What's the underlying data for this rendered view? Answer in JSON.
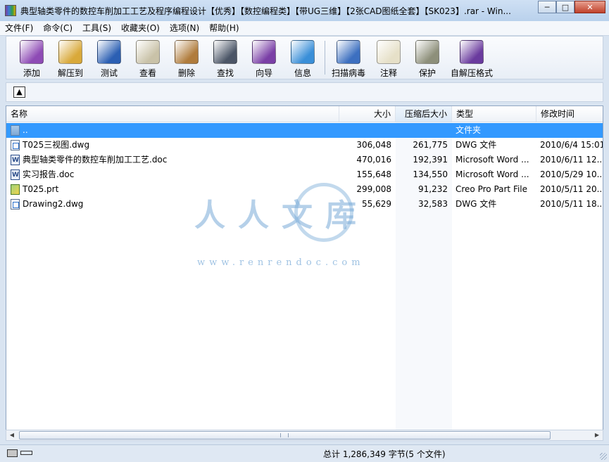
{
  "window": {
    "title": "典型轴类零件的数控车削加工工艺及程序编程设计【优秀】【数控编程类】【带UG三维】【2张CAD图纸全套】【SK023】.rar - Win...",
    "minimize": "─",
    "maximize": "□",
    "close": "✕"
  },
  "menu": {
    "items": [
      {
        "label": "文件(F)"
      },
      {
        "label": "命令(C)"
      },
      {
        "label": "工具(S)"
      },
      {
        "label": "收藏夹(O)"
      },
      {
        "label": "选项(N)"
      },
      {
        "label": "帮助(H)"
      }
    ]
  },
  "toolbar": {
    "buttons": [
      {
        "label": "添加",
        "icon": "add-archive-icon",
        "color": "#8e4bb5"
      },
      {
        "label": "解压到",
        "icon": "extract-to-icon",
        "color": "#d9a93a"
      },
      {
        "label": "测试",
        "icon": "test-icon",
        "color": "#2b5fb3"
      },
      {
        "label": "查看",
        "icon": "view-icon",
        "color": "#c9c2a8"
      },
      {
        "label": "删除",
        "icon": "delete-icon",
        "color": "#b07c3c"
      },
      {
        "label": "查找",
        "icon": "find-icon",
        "color": "#4b5566"
      },
      {
        "label": "向导",
        "icon": "wizard-icon",
        "color": "#7a3fa6"
      },
      {
        "label": "信息",
        "icon": "info-icon",
        "color": "#3a8fd8"
      },
      {
        "label": "扫描病毒",
        "icon": "scan-virus-icon",
        "color": "#3c6fc0"
      },
      {
        "label": "注释",
        "icon": "comment-icon",
        "color": "#e6e0c8"
      },
      {
        "label": "保护",
        "icon": "protect-icon",
        "color": "#8d8f7a"
      },
      {
        "label": "自解压格式",
        "icon": "sfx-icon",
        "color": "#6a3b9e"
      }
    ]
  },
  "columns": {
    "name": "名称",
    "size": "大小",
    "packed": "压缩后大小",
    "type": "类型",
    "modified": "修改时间"
  },
  "files": [
    {
      "name": "..",
      "size": "",
      "packed": "",
      "type": "文件夹",
      "modified": "",
      "icon": "folder"
    },
    {
      "name": "T025三视图.dwg",
      "size": "306,048",
      "packed": "261,775",
      "type": "DWG 文件",
      "modified": "2010/6/4 15:01",
      "icon": "dwg"
    },
    {
      "name": "典型轴类零件的数控车削加工工艺.doc",
      "size": "470,016",
      "packed": "192,391",
      "type": "Microsoft Word ...",
      "modified": "2010/6/11 12...",
      "icon": "doc"
    },
    {
      "name": "实习报告.doc",
      "size": "155,648",
      "packed": "134,550",
      "type": "Microsoft Word ...",
      "modified": "2010/5/29 10...",
      "icon": "doc"
    },
    {
      "name": "T025.prt",
      "size": "299,008",
      "packed": "91,232",
      "type": "Creo Pro Part File",
      "modified": "2010/5/11 20...",
      "icon": "prt"
    },
    {
      "name": "Drawing2.dwg",
      "size": "55,629",
      "packed": "32,583",
      "type": "DWG 文件",
      "modified": "2010/5/11 18...",
      "icon": "dwg"
    }
  ],
  "watermark": {
    "text": "人人文库",
    "url": "www.renrendoc.com"
  },
  "status": {
    "summary": "总计 1,286,349 字节(5 个文件)"
  },
  "colors": {
    "selection": "#3399ff",
    "background": "#d9e4f1"
  }
}
